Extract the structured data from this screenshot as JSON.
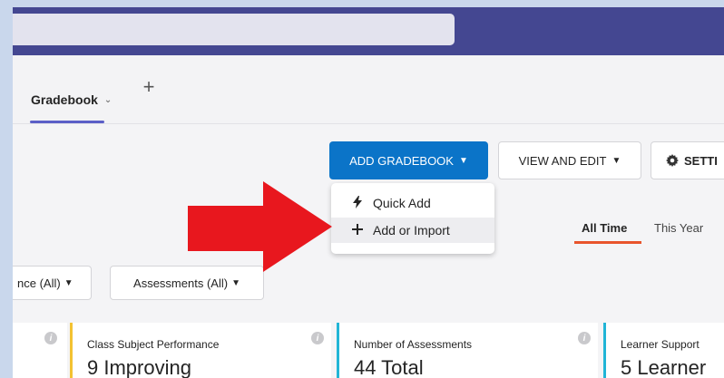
{
  "tabs": {
    "active_label": "Gradebook",
    "chevron": "⌄",
    "add_tab": "+"
  },
  "toolbar": {
    "add_gradebook_label": "ADD GRADEBOOK",
    "view_edit_label": "VIEW AND EDIT",
    "settings_label": "SETTI"
  },
  "dropdown": {
    "items": [
      {
        "label": "Quick Add",
        "icon": "lightning-icon"
      },
      {
        "label": "Add or Import",
        "icon": "plus-icon"
      }
    ]
  },
  "time_tabs": {
    "all_time": "All Time",
    "this_year": "This Year"
  },
  "filters": {
    "attendance": "nce (All)",
    "assessments": "Assessments (All)"
  },
  "cards": [
    {
      "title": "Class Subject Performance",
      "value": "9 Improving"
    },
    {
      "title": "Number of Assessments",
      "value": "44 Total"
    },
    {
      "title": "Learner Support",
      "value": "5 Learner"
    }
  ],
  "colors": {
    "topbar": "#444791",
    "primary": "#0b74c8",
    "annotation_arrow": "#e8171e",
    "time_underline": "#e8542c"
  }
}
